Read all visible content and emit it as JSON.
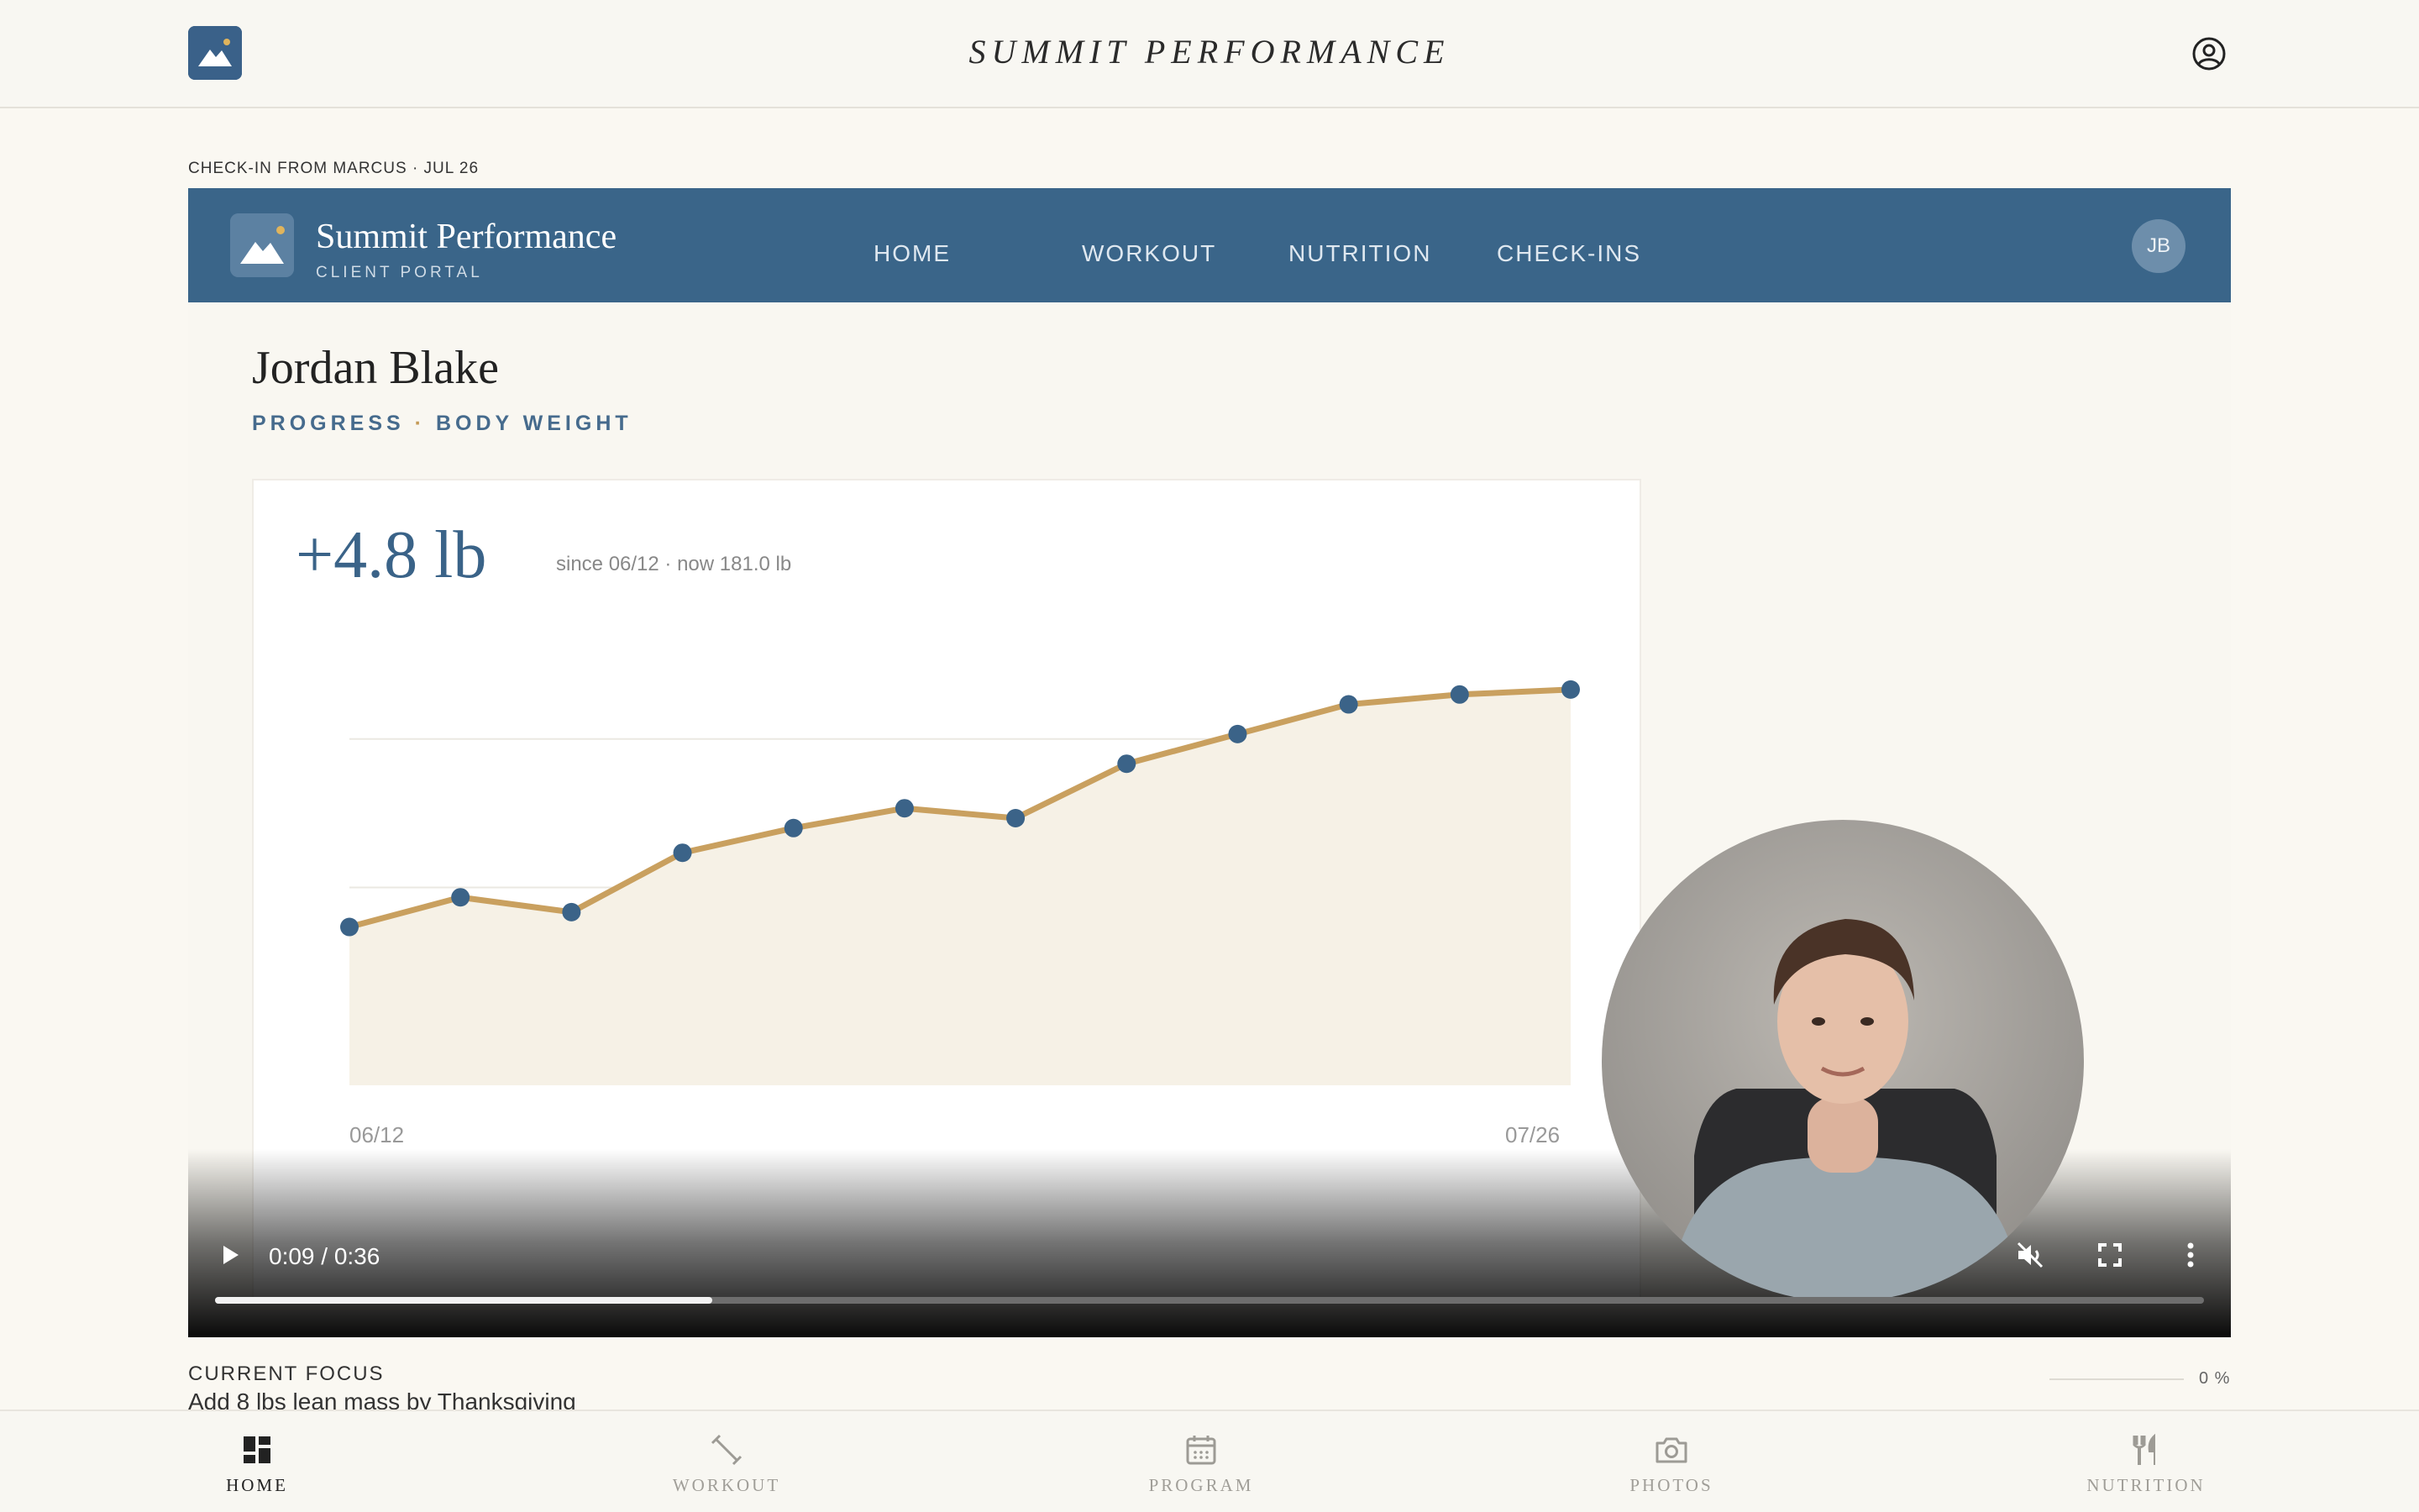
{
  "header": {
    "brand_title": "SUMMIT PERFORMANCE",
    "logo_icon": "mountain-logo-icon",
    "account_icon": "account-circle-icon"
  },
  "checkin_label": "CHECK-IN FROM MARCUS · JUL 26",
  "video": {
    "portal": {
      "name": "Summit Performance",
      "subtitle": "CLIENT PORTAL",
      "nav": [
        "HOME",
        "WORKOUT",
        "NUTRITION",
        "CHECK-INS"
      ],
      "avatar_initials": "JB"
    },
    "client": {
      "name": "Jordan Blake",
      "section": "PROGRESS",
      "metric": "BODY WEIGHT",
      "separator": "·"
    },
    "summary": {
      "delta": "+4.8 lb",
      "since": "since 06/12 · now 181.0 lb"
    },
    "chart_data": {
      "type": "line",
      "x": [
        "06/12",
        "06/16",
        "06/20",
        "06/24",
        "06/28",
        "07/02",
        "07/06",
        "07/10",
        "07/14",
        "07/18",
        "07/22",
        "07/26"
      ],
      "tick_labels": [
        "06/12",
        "07/26"
      ],
      "series": [
        {
          "values": [
            176.2,
            176.8,
            176.5,
            177.7,
            178.2,
            178.6,
            178.4,
            179.5,
            180.1,
            180.7,
            180.9,
            181.0
          ]
        }
      ],
      "ylim": [
        173.0,
        182.0
      ],
      "grid": true,
      "colors": {
        "line": "#c9a05f",
        "point": "#3b6388",
        "fill": "#f6f1e6"
      }
    },
    "player": {
      "time": "0:09 / 0:36",
      "progress": 0.25,
      "play_icon": "play-icon",
      "mute_icon": "volume-muted-icon",
      "fullscreen_icon": "fullscreen-icon",
      "more_icon": "more-vertical-icon"
    }
  },
  "focus": {
    "label": "CURRENT FOCUS",
    "text": "Add 8 lbs lean mass by Thanksgiving",
    "percent_label": "0 %",
    "percent": 0
  },
  "bottom_nav": [
    {
      "label": "HOME",
      "icon": "dashboard-icon",
      "active": true
    },
    {
      "label": "WORKOUT",
      "icon": "dumbbell-icon",
      "active": false
    },
    {
      "label": "PROGRAM",
      "icon": "calendar-icon",
      "active": false
    },
    {
      "label": "PHOTOS",
      "icon": "camera-icon",
      "active": false
    },
    {
      "label": "NUTRITION",
      "icon": "fork-knife-icon",
      "active": false
    }
  ],
  "colors": {
    "brand_blue": "#3a6589",
    "accent_gold": "#c9a05f",
    "background": "#faf8f2"
  }
}
